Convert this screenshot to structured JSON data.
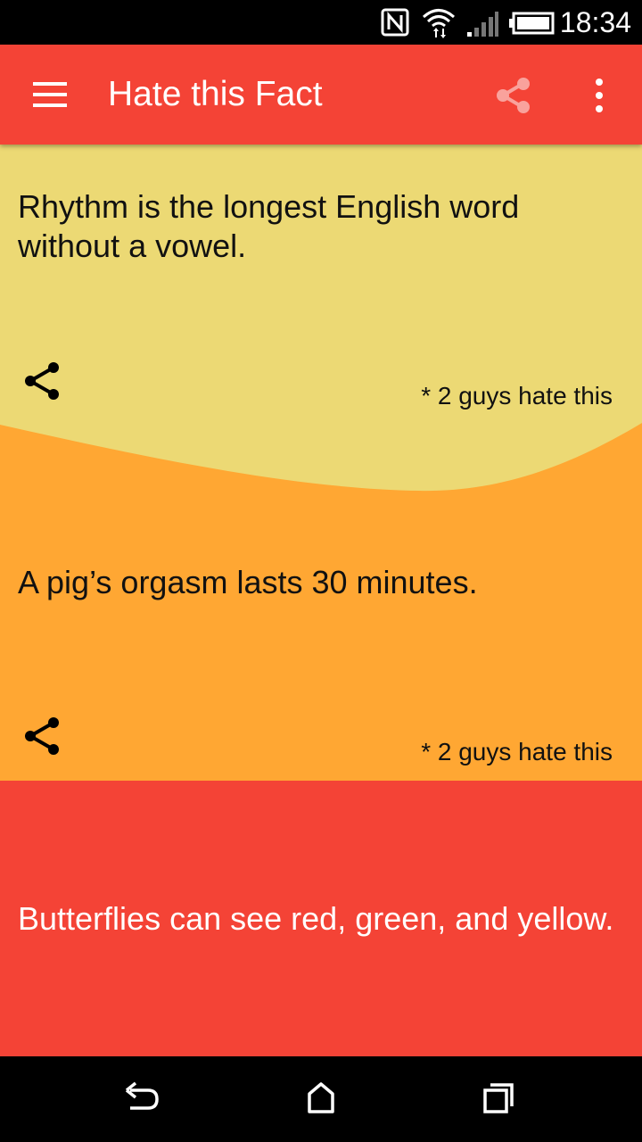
{
  "status_bar": {
    "time": "18:34"
  },
  "app_bar": {
    "title": "Hate this Fact"
  },
  "facts": [
    {
      "text": "Rhythm is the longest English word without a vowel.",
      "hate_count": "* 2 guys hate this",
      "color": "#ecd974"
    },
    {
      "text": "A pig’s orgasm lasts 30 minutes.",
      "hate_count": "* 2 guys hate this",
      "color": "#ffa733"
    },
    {
      "text": "Butterflies can see red, green, and yellow.",
      "color": "#f44336"
    }
  ],
  "colors": {
    "accent": "#f44336",
    "status_bar": "#000000",
    "nav_bar": "#000000"
  }
}
